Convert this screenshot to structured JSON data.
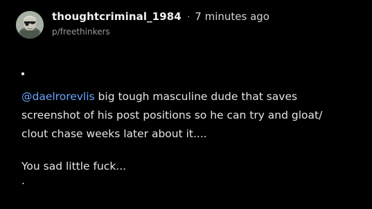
{
  "post": {
    "author": "thoughtcriminal_1984",
    "separator": "·",
    "time_ago": "7 minutes ago",
    "community": "p/freethinkers",
    "mention": "@daelrorevlis",
    "lines": [
      " big tough masculine dude that saves",
      "screenshot of his post positions so he can try and gloat/",
      "clout chase weeks later about it...."
    ],
    "second_paragraph": "You sad little fuck...",
    "trailing_dot": "."
  },
  "colors": {
    "background": "#000000",
    "mention": "#6ba6ff",
    "muted": "#9a9a9a"
  },
  "icons": {
    "avatar": "user-avatar"
  }
}
